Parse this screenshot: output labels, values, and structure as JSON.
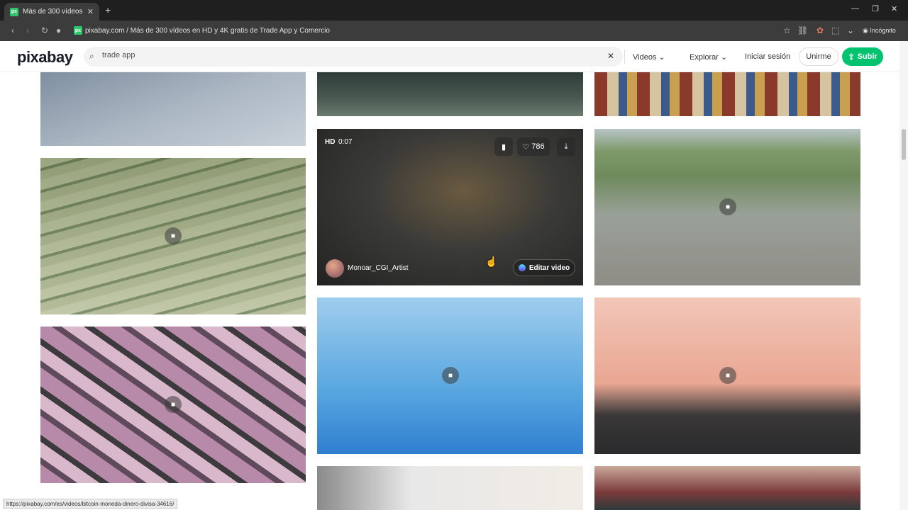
{
  "browser": {
    "tab_title": "Más de 300 vídeos en HD y 4K",
    "favicon_text": "px",
    "url": "pixabay.com / Más de 300 vídeos en HD y 4K gratis de Trade App y Comercio",
    "incognito": "Incógnito",
    "status_url": "https://pixabay.com/es/videos/bitcoin-moneda-dinero-divisa-34616/"
  },
  "header": {
    "logo": "pixabay",
    "search_value": "trade app",
    "media_type": "Videos",
    "explore": "Explorar",
    "login": "Iniciar sesión",
    "join": "Unirme",
    "upload": "Subir"
  },
  "hover_card": {
    "quality": "HD",
    "duration": "0:07",
    "likes": "786",
    "author": "Monoar_CGI_Artist",
    "edit": "Editar video"
  },
  "colors": {
    "brand": "#00c26f",
    "chrome_dark": "#1f1f1f"
  }
}
